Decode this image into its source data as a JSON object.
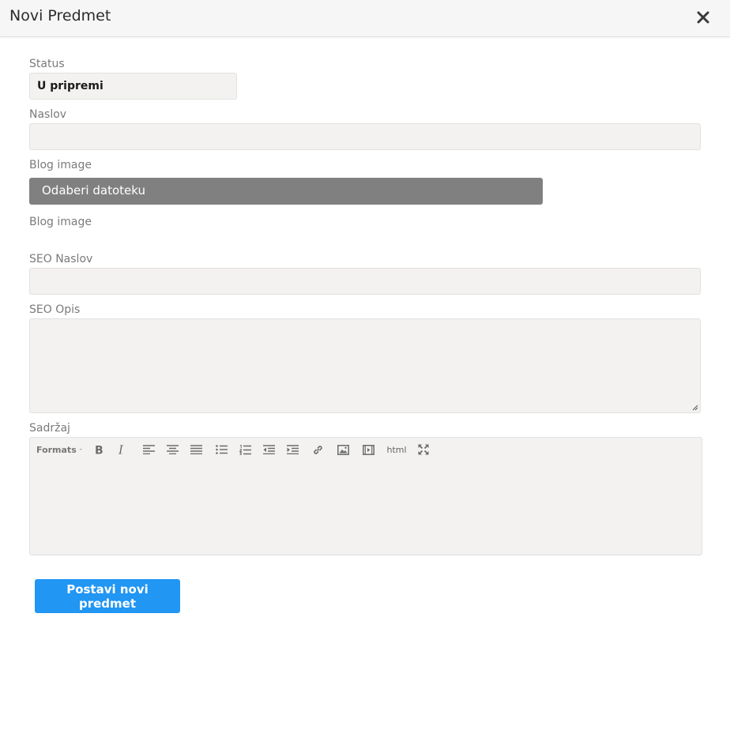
{
  "modal": {
    "title": "Novi Predmet",
    "close_icon": "close-icon"
  },
  "form": {
    "status": {
      "label": "Status",
      "value": "U pripremi"
    },
    "naslov": {
      "label": "Naslov",
      "value": ""
    },
    "blog_image": {
      "label": "Blog image",
      "button_label": "Odaberi datoteku",
      "preview_label": "Blog image"
    },
    "seo_naslov": {
      "label": "SEO Naslov",
      "value": ""
    },
    "seo_opis": {
      "label": "SEO Opis",
      "value": ""
    },
    "sadrzaj": {
      "label": "Sadržaj",
      "toolbar": {
        "formats_label": "Formats",
        "html_label": "html",
        "icons": [
          "bold-icon",
          "italic-icon",
          "align-left-icon",
          "align-center-icon",
          "align-justify-icon",
          "bullet-list-icon",
          "numbered-list-icon",
          "outdent-icon",
          "indent-icon",
          "link-icon",
          "image-icon",
          "video-icon",
          "fullscreen-icon"
        ]
      }
    },
    "submit_label": "Postavi novi predmet"
  },
  "colors": {
    "primary": "#2196f3",
    "file_button": "#808080",
    "field_bg": "#f3f2f1",
    "header_bg": "#f6f6f6"
  }
}
